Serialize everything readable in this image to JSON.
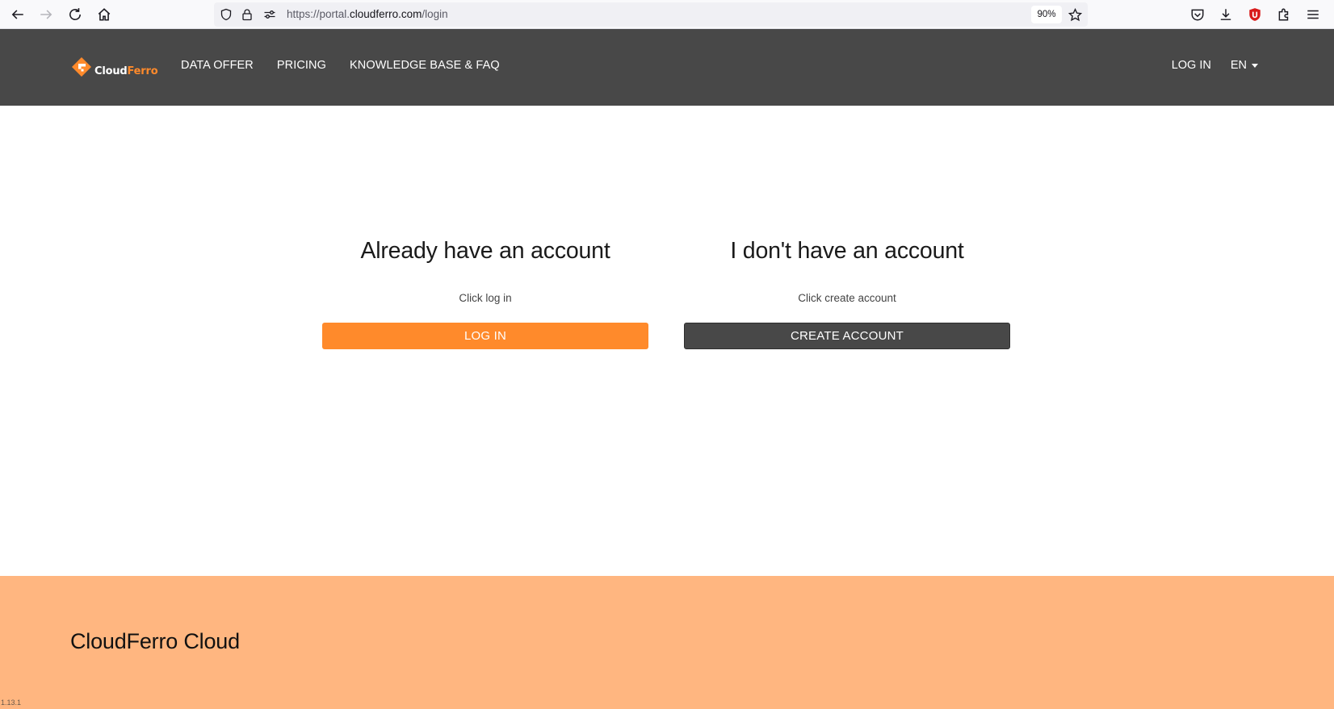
{
  "browser": {
    "url_prefix": "https://portal.",
    "url_host": "cloudferro.com",
    "url_path": "/login",
    "zoom": "90%"
  },
  "header": {
    "logo_word_1": "Cloud",
    "logo_word_2": "Ferro",
    "nav": [
      "DATA OFFER",
      "PRICING",
      "KNOWLEDGE BASE & FAQ"
    ],
    "login_link": "LOG IN",
    "language": "EN"
  },
  "main": {
    "login_card": {
      "heading": "Already have an account",
      "subtext": "Click log in",
      "button": "LOG IN"
    },
    "create_card": {
      "heading": "I don't have an account",
      "subtext": "Click create account",
      "button": "CREATE ACCOUNT"
    }
  },
  "footer": {
    "title": "CloudFerro Cloud",
    "version": "1.13.1"
  },
  "colors": {
    "accent": "#ff8a2b",
    "header_bg": "#484848",
    "footer_bg": "#ffb680"
  }
}
